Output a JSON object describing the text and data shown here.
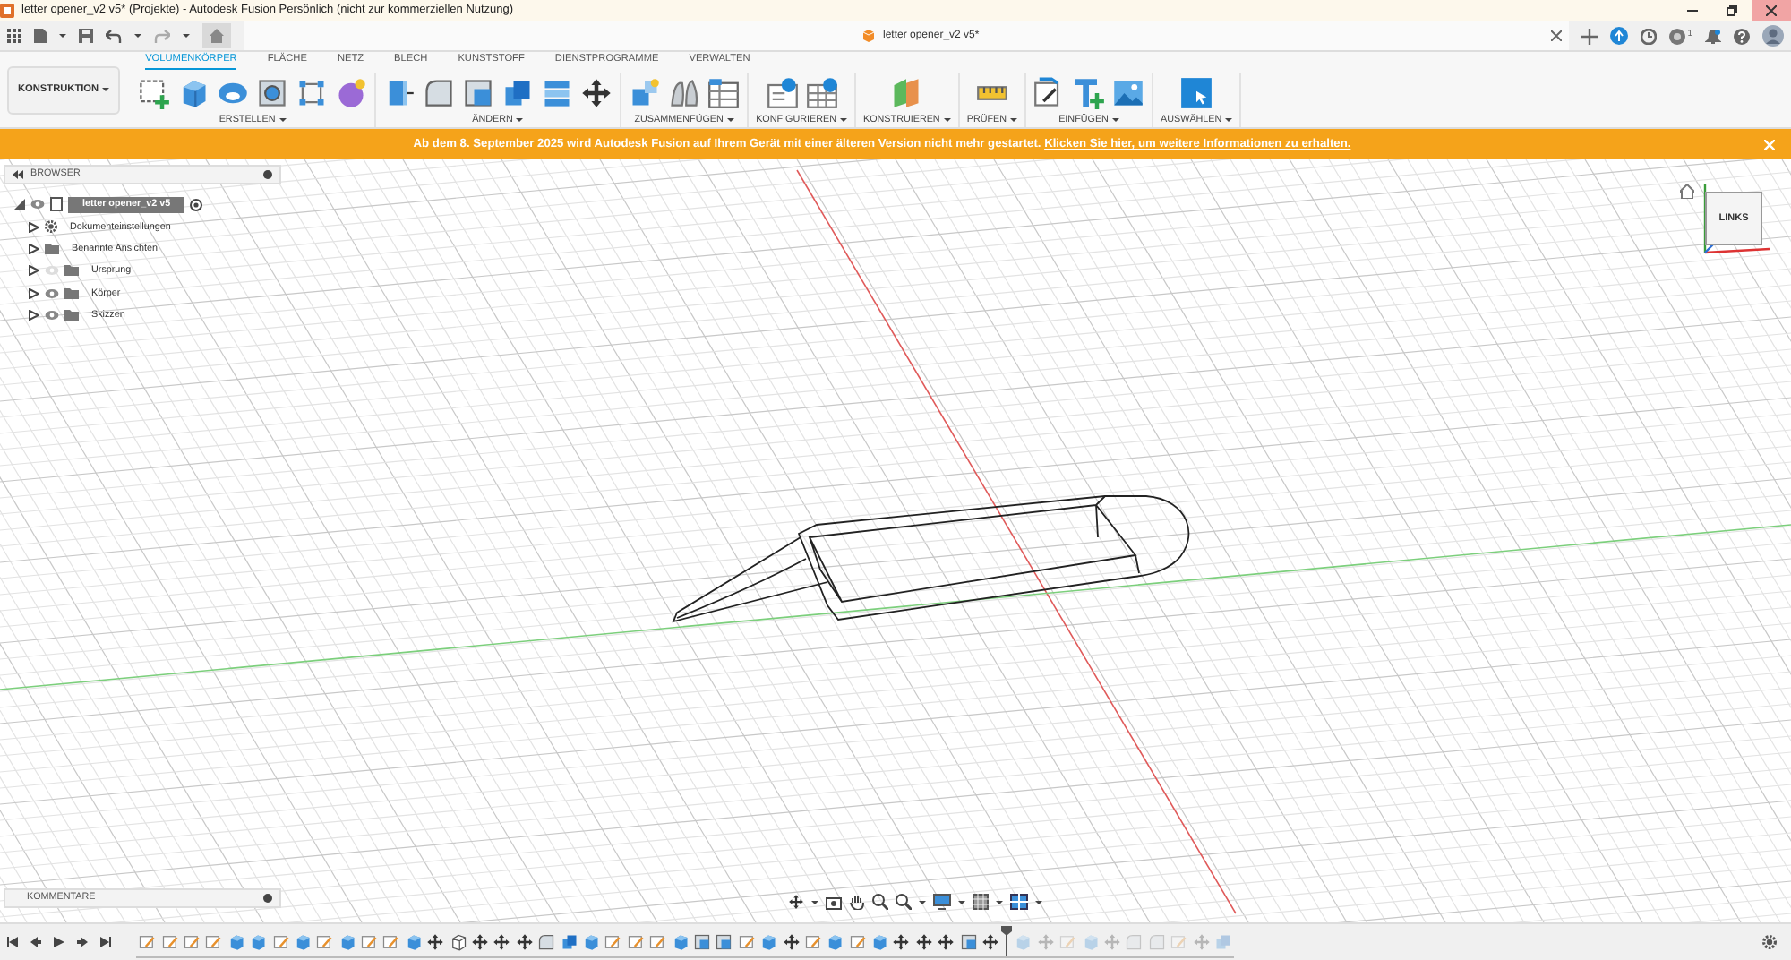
{
  "window": {
    "title": "letter opener_v2 v5* (Projekte) - Autodesk Fusion Persönlich (nicht zur kommerziellen Nutzung)"
  },
  "document_tab": {
    "title": "letter opener_v2 v5*"
  },
  "job_status": {
    "count": "1"
  },
  "workspace": {
    "label": "KONSTRUKTION"
  },
  "ribbon_tabs": [
    {
      "label": "VOLUMENKÖRPER",
      "selected": true
    },
    {
      "label": "FLÄCHE",
      "selected": false
    },
    {
      "label": "NETZ",
      "selected": false
    },
    {
      "label": "BLECH",
      "selected": false
    },
    {
      "label": "KUNSTSTOFF",
      "selected": false
    },
    {
      "label": "DIENSTPROGRAMME",
      "selected": false
    },
    {
      "label": "VERWALTEN",
      "selected": false
    }
  ],
  "ribbon_groups": [
    {
      "label": "ERSTELLEN",
      "tools": [
        {
          "kind": "sketchplus"
        },
        {
          "kind": "cube"
        },
        {
          "kind": "torus"
        },
        {
          "kind": "hole"
        },
        {
          "kind": "pattern"
        },
        {
          "kind": "sphere"
        }
      ]
    },
    {
      "label": "ÄNDERN",
      "tools": [
        {
          "kind": "pushpull"
        },
        {
          "kind": "fillet"
        },
        {
          "kind": "shell"
        },
        {
          "kind": "combine"
        },
        {
          "kind": "layers"
        },
        {
          "kind": "move"
        }
      ]
    },
    {
      "label": "ZUSAMMENFÜGEN",
      "tools": [
        {
          "kind": "joint"
        },
        {
          "kind": "contact"
        },
        {
          "kind": "table"
        }
      ]
    },
    {
      "label": "KONFIGURIEREN",
      "tools": [
        {
          "kind": "param"
        },
        {
          "kind": "param2"
        }
      ]
    },
    {
      "label": "KONSTRUIEREN",
      "tools": [
        {
          "kind": "plane"
        }
      ]
    },
    {
      "label": "PRÜFEN",
      "tools": [
        {
          "kind": "ruler"
        }
      ]
    },
    {
      "label": "EINFÜGEN",
      "tools": [
        {
          "kind": "link"
        },
        {
          "kind": "tshape"
        },
        {
          "kind": "image"
        }
      ]
    },
    {
      "label": "AUSWÄHLEN",
      "tools": [
        {
          "kind": "select"
        }
      ]
    }
  ],
  "banner": {
    "text": "Ab dem 8. September 2025 wird Autodesk Fusion auf Ihrem Gerät mit einer älteren Version nicht mehr gestartet.",
    "link": "Klicken Sie hier, um weitere Informationen zu erhalten."
  },
  "browser": {
    "title": "BROWSER",
    "root": {
      "label": "letter opener_v2 v5",
      "expanded": true,
      "visible": true,
      "selected": true
    },
    "items": [
      {
        "label": "Dokumenteinstellungen",
        "kind": "settings",
        "expanded": false,
        "selected": false
      },
      {
        "label": "Benannte Ansichten",
        "kind": "views",
        "expanded": false,
        "selected": false
      },
      {
        "label": "Ursprung",
        "kind": "folder",
        "expanded": false,
        "visible": false,
        "selected": false
      },
      {
        "label": "Körper",
        "kind": "folder",
        "expanded": false,
        "visible": true,
        "selected": false
      },
      {
        "label": "Skizzen",
        "kind": "folder",
        "expanded": false,
        "visible": true,
        "selected": false
      }
    ]
  },
  "view_cube": {
    "face": "LINKS"
  },
  "comments_panel": {
    "title": "KOMMENTARE"
  },
  "timeline": {
    "items": [
      {
        "kind": "sketch",
        "rolled_back": false
      },
      {
        "kind": "sketch",
        "rolled_back": false
      },
      {
        "kind": "sketch",
        "rolled_back": false
      },
      {
        "kind": "sketch",
        "rolled_back": false
      },
      {
        "kind": "extrude",
        "rolled_back": false
      },
      {
        "kind": "extrude",
        "rolled_back": false
      },
      {
        "kind": "sketch",
        "rolled_back": false
      },
      {
        "kind": "extrude",
        "rolled_back": false
      },
      {
        "kind": "sketch",
        "rolled_back": false
      },
      {
        "kind": "extrude",
        "rolled_back": false
      },
      {
        "kind": "sketch",
        "rolled_back": false
      },
      {
        "kind": "sketch",
        "rolled_back": false
      },
      {
        "kind": "extrude",
        "rolled_back": false
      },
      {
        "kind": "move",
        "rolled_back": false
      },
      {
        "kind": "box",
        "rolled_back": false
      },
      {
        "kind": "move",
        "rolled_back": false
      },
      {
        "kind": "move",
        "rolled_back": false
      },
      {
        "kind": "move",
        "rolled_back": false
      },
      {
        "kind": "fillet",
        "rolled_back": false
      },
      {
        "kind": "combine",
        "rolled_back": false
      },
      {
        "kind": "extrude",
        "rolled_back": false
      },
      {
        "kind": "sketch",
        "rolled_back": false
      },
      {
        "kind": "sketch",
        "rolled_back": false
      },
      {
        "kind": "sketch",
        "rolled_back": false
      },
      {
        "kind": "extrude",
        "rolled_back": false
      },
      {
        "kind": "shell",
        "rolled_back": false
      },
      {
        "kind": "shell",
        "rolled_back": false
      },
      {
        "kind": "sketch",
        "rolled_back": false
      },
      {
        "kind": "extrude",
        "rolled_back": false
      },
      {
        "kind": "move",
        "rolled_back": false
      },
      {
        "kind": "sketch",
        "rolled_back": false
      },
      {
        "kind": "extrude",
        "rolled_back": false
      },
      {
        "kind": "sketch",
        "rolled_back": false
      },
      {
        "kind": "extrude",
        "rolled_back": false
      },
      {
        "kind": "move",
        "rolled_back": false
      },
      {
        "kind": "move",
        "rolled_back": false
      },
      {
        "kind": "move",
        "rolled_back": false
      },
      {
        "kind": "shell",
        "rolled_back": false
      },
      {
        "kind": "move",
        "rolled_back": false
      },
      {
        "kind": "extrude",
        "rolled_back": true
      },
      {
        "kind": "move",
        "rolled_back": true
      },
      {
        "kind": "sketch",
        "rolled_back": true
      },
      {
        "kind": "extrude",
        "rolled_back": true
      },
      {
        "kind": "move",
        "rolled_back": true
      },
      {
        "kind": "fillet",
        "rolled_back": true
      },
      {
        "kind": "fillet",
        "rolled_back": true
      },
      {
        "kind": "sketch",
        "rolled_back": true
      },
      {
        "kind": "move",
        "rolled_back": true
      },
      {
        "kind": "combine",
        "rolled_back": true
      }
    ]
  }
}
